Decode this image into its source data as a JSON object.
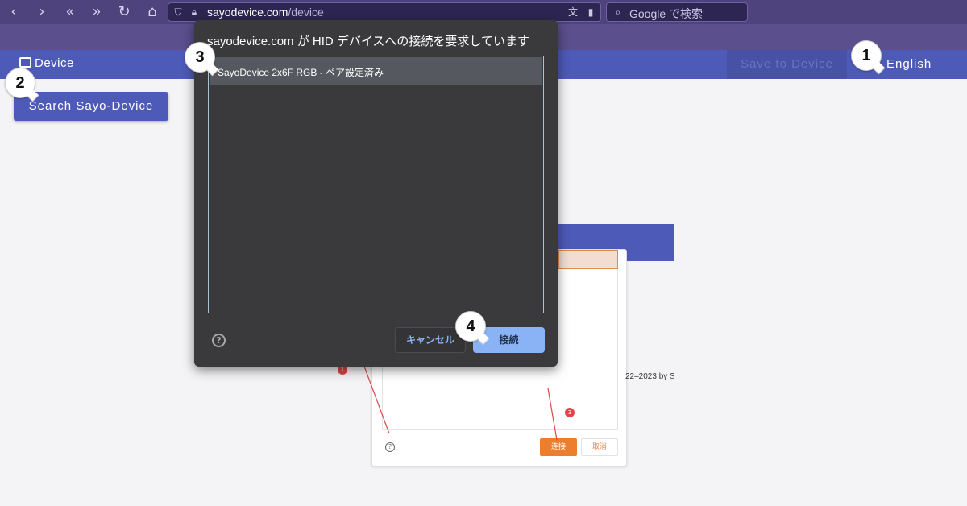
{
  "browser": {
    "url_host": "sayodevice.com",
    "url_path": "/device",
    "search_placeholder": "Google で検索",
    "icons": [
      "back-icon",
      "forward-icon",
      "rewind-icon",
      "fast-forward-icon",
      "reload-icon",
      "home-icon",
      "shield-icon",
      "lock-icon",
      "translate-icon",
      "bookmark-icon",
      "search-icon"
    ]
  },
  "header": {
    "device_label": "Device",
    "save_label": "Save to Device",
    "language_label": "English"
  },
  "main": {
    "search_button_label": "Search Sayo-Device"
  },
  "dialog": {
    "title": "sayodevice.com が HID デバイスへの接続を要求しています",
    "devices": [
      {
        "label": "SayoDevice 2x6F RGB - ペア設定済み"
      }
    ],
    "help_icon": "?",
    "cancel_label": "キャンセル",
    "connect_label": "接続"
  },
  "inset": {
    "connect_label": "连接",
    "cancel_label": "取消",
    "help_icon": "?",
    "badges": [
      "1",
      "3"
    ],
    "copyright_text": "22–2023 by S"
  },
  "callouts": [
    "1",
    "2",
    "3",
    "4"
  ],
  "colors": {
    "chrome_toolbar": "#4f437d",
    "app_header": "#4e5ab8",
    "dialog_bg": "#3a3a3c",
    "dialog_accent": "#8ab3f5",
    "inset_connect": "#ec7e2e"
  }
}
